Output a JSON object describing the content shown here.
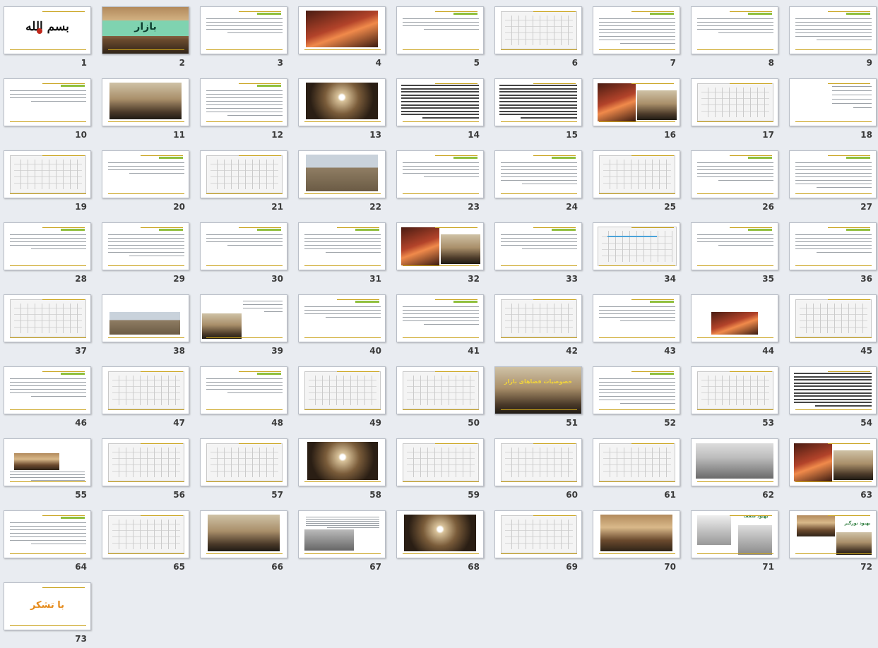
{
  "title_slide": {
    "logo_glyphs": "بسم الله",
    "cover_title": "بازار",
    "overlay_title": "خصوصیات فضاهای بازار",
    "closing_text": "با تشکر",
    "label_71": "بهبود سقف",
    "label_72": "بهبود نورگیر"
  },
  "colors": {
    "background": "#e9ecf1",
    "accent_line": "#c9a21a",
    "title_green": "#8fbf3b",
    "thanks_orange": "#e58a1a"
  },
  "slides": [
    {
      "n": "1",
      "kind": "logo"
    },
    {
      "n": "2",
      "kind": "cover"
    },
    {
      "n": "3",
      "kind": "text"
    },
    {
      "n": "4",
      "kind": "photo"
    },
    {
      "n": "5",
      "kind": "text"
    },
    {
      "n": "6",
      "kind": "drawing"
    },
    {
      "n": "7",
      "kind": "text"
    },
    {
      "n": "8",
      "kind": "text"
    },
    {
      "n": "9",
      "kind": "text"
    },
    {
      "n": "10",
      "kind": "text"
    },
    {
      "n": "11",
      "kind": "photo"
    },
    {
      "n": "12",
      "kind": "text"
    },
    {
      "n": "13",
      "kind": "photo"
    },
    {
      "n": "14",
      "kind": "dense"
    },
    {
      "n": "15",
      "kind": "dense"
    },
    {
      "n": "16",
      "kind": "twophoto"
    },
    {
      "n": "17",
      "kind": "drawing"
    },
    {
      "n": "18",
      "kind": "list"
    },
    {
      "n": "19",
      "kind": "drawing"
    },
    {
      "n": "20",
      "kind": "text"
    },
    {
      "n": "21",
      "kind": "drawing"
    },
    {
      "n": "22",
      "kind": "photo"
    },
    {
      "n": "23",
      "kind": "text"
    },
    {
      "n": "24",
      "kind": "text"
    },
    {
      "n": "25",
      "kind": "drawing"
    },
    {
      "n": "26",
      "kind": "text"
    },
    {
      "n": "27",
      "kind": "text"
    },
    {
      "n": "28",
      "kind": "text"
    },
    {
      "n": "29",
      "kind": "text"
    },
    {
      "n": "30",
      "kind": "text"
    },
    {
      "n": "31",
      "kind": "text"
    },
    {
      "n": "32",
      "kind": "twophoto"
    },
    {
      "n": "33",
      "kind": "text"
    },
    {
      "n": "34",
      "kind": "map"
    },
    {
      "n": "35",
      "kind": "text"
    },
    {
      "n": "36",
      "kind": "text"
    },
    {
      "n": "37",
      "kind": "drawing"
    },
    {
      "n": "38",
      "kind": "photo"
    },
    {
      "n": "39",
      "kind": "photo"
    },
    {
      "n": "40",
      "kind": "text"
    },
    {
      "n": "41",
      "kind": "text"
    },
    {
      "n": "42",
      "kind": "drawing"
    },
    {
      "n": "43",
      "kind": "text"
    },
    {
      "n": "44",
      "kind": "photo"
    },
    {
      "n": "45",
      "kind": "drawing"
    },
    {
      "n": "46",
      "kind": "text"
    },
    {
      "n": "47",
      "kind": "drawing"
    },
    {
      "n": "48",
      "kind": "text"
    },
    {
      "n": "49",
      "kind": "drawing"
    },
    {
      "n": "50",
      "kind": "drawing"
    },
    {
      "n": "51",
      "kind": "overlay"
    },
    {
      "n": "52",
      "kind": "text"
    },
    {
      "n": "53",
      "kind": "drawing"
    },
    {
      "n": "54",
      "kind": "dense"
    },
    {
      "n": "55",
      "kind": "photo"
    },
    {
      "n": "56",
      "kind": "drawing"
    },
    {
      "n": "57",
      "kind": "drawing"
    },
    {
      "n": "58",
      "kind": "photo"
    },
    {
      "n": "59",
      "kind": "drawing"
    },
    {
      "n": "60",
      "kind": "drawing"
    },
    {
      "n": "61",
      "kind": "drawing"
    },
    {
      "n": "62",
      "kind": "photo"
    },
    {
      "n": "63",
      "kind": "twophoto"
    },
    {
      "n": "64",
      "kind": "text"
    },
    {
      "n": "65",
      "kind": "drawing"
    },
    {
      "n": "66",
      "kind": "photo"
    },
    {
      "n": "67",
      "kind": "photo"
    },
    {
      "n": "68",
      "kind": "photo"
    },
    {
      "n": "69",
      "kind": "drawing"
    },
    {
      "n": "70",
      "kind": "photo"
    },
    {
      "n": "71",
      "kind": "twophoto"
    },
    {
      "n": "72",
      "kind": "twophoto"
    },
    {
      "n": "73",
      "kind": "thanks"
    }
  ]
}
